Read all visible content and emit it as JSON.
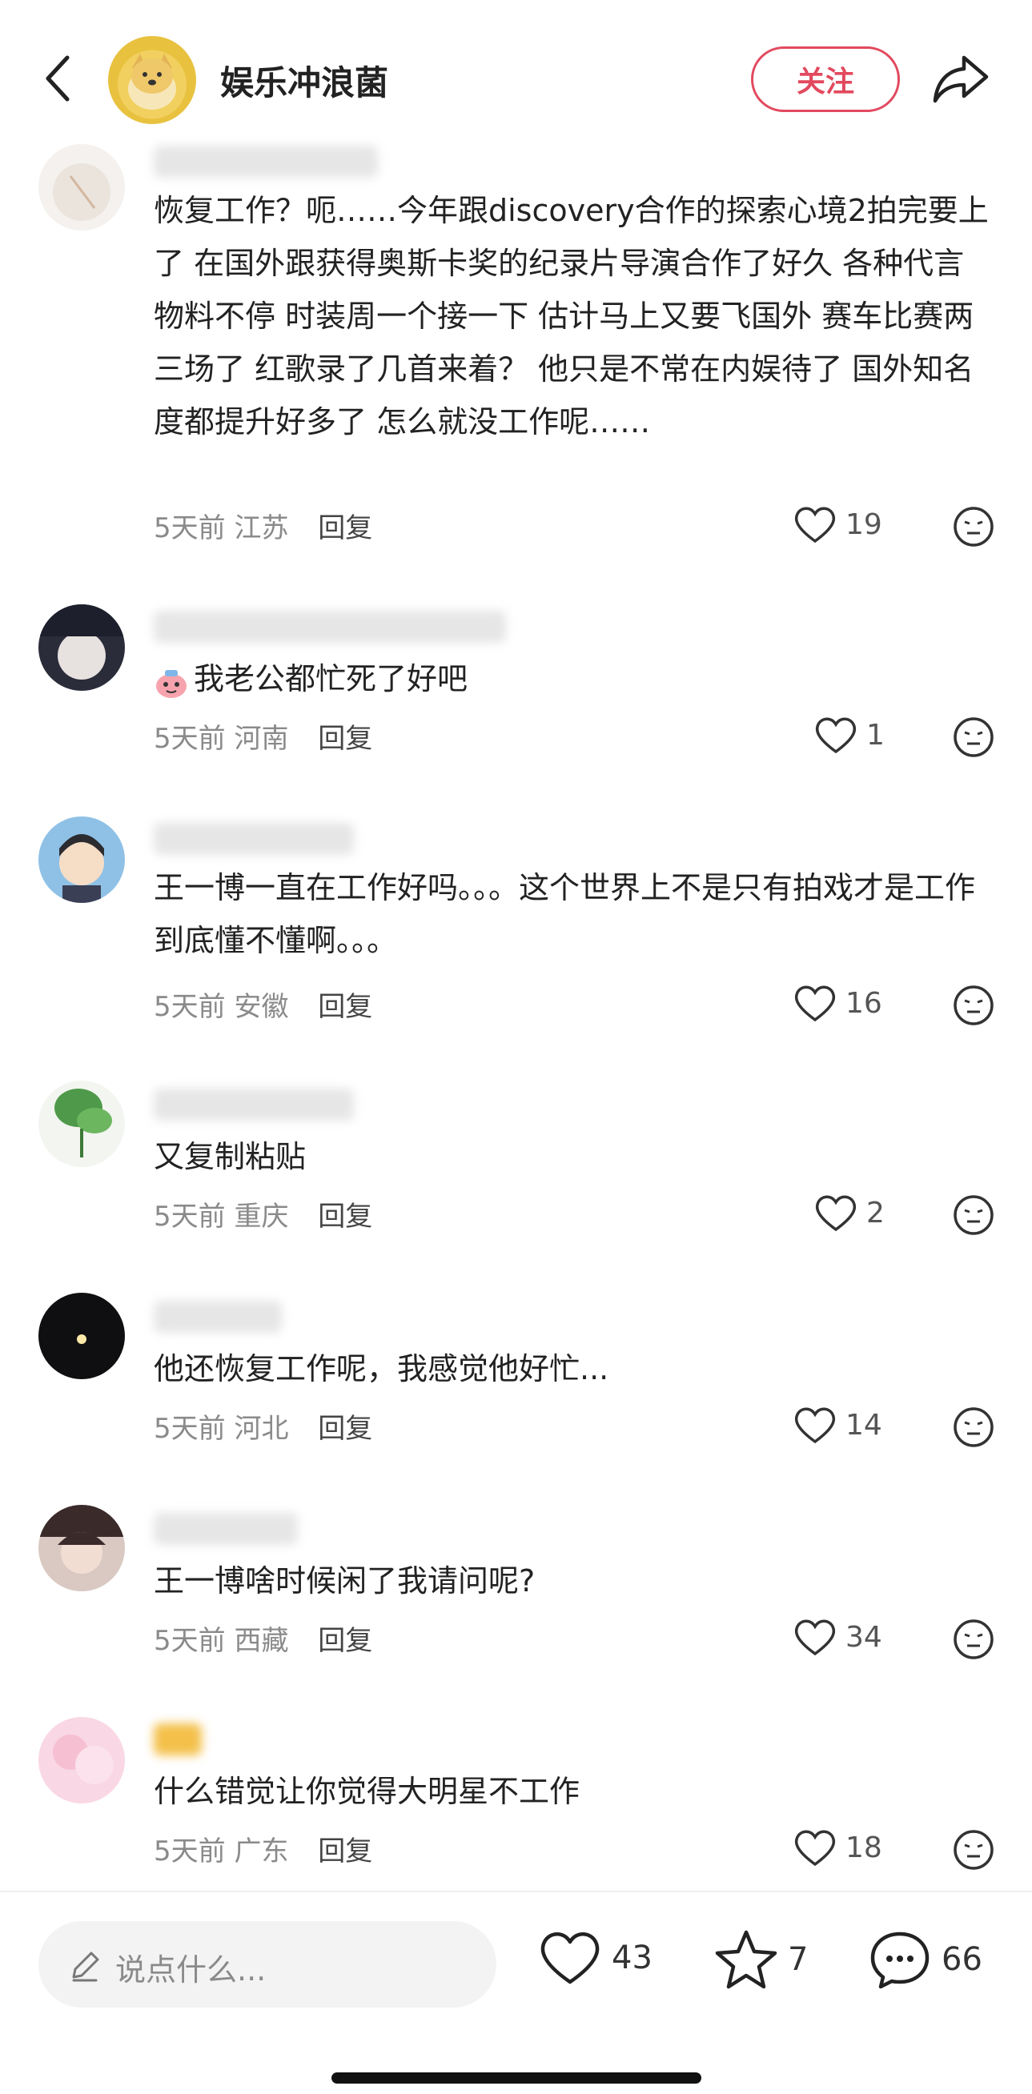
{
  "header": {
    "author_name": "娱乐冲浪菌",
    "follow_label": "关注"
  },
  "comments": [
    {
      "text": "恢复工作？呃……今年跟discovery合作的探索心境2拍完要上了 在国外跟获得奥斯卡奖的纪录片导演合作了好久 各种代言物料不停 时装周一个接一下 估计马上又要飞国外 赛车比赛两三场了 红歌录了几首来着？ 他只是不常在内娱待了 国外知名度都提升好多了 怎么就没工作呢……",
      "time": "5天前",
      "location": "江苏",
      "reply": "回复",
      "likes": "19"
    },
    {
      "text": "我老公都忙死了好吧",
      "time": "5天前",
      "location": "河南",
      "reply": "回复",
      "likes": "1"
    },
    {
      "text": "王一博一直在工作好吗。。。这个世界上不是只有拍戏才是工作到底懂不懂啊。。。",
      "time": "5天前",
      "location": "安徽",
      "reply": "回复",
      "likes": "16"
    },
    {
      "text": "又复制粘贴",
      "time": "5天前",
      "location": "重庆",
      "reply": "回复",
      "likes": "2"
    },
    {
      "text": "他还恢复工作呢，我感觉他好忙...",
      "time": "5天前",
      "location": "河北",
      "reply": "回复",
      "likes": "14"
    },
    {
      "text": "王一博啥时候闲了我请问呢?",
      "time": "5天前",
      "location": "西藏",
      "reply": "回复",
      "likes": "34"
    },
    {
      "text": "什么错觉让你觉得大明星不工作",
      "time": "5天前",
      "location": "广东",
      "reply": "回复",
      "likes": "18"
    }
  ],
  "bottom_bar": {
    "input_placeholder": "说点什么...",
    "like_count": "43",
    "star_count": "7",
    "comment_count": "66"
  },
  "icons": {
    "back": "chevron-left-icon",
    "share": "share-arrow-icon",
    "like": "heart-outline-icon",
    "emoji": "emoji-face-icon",
    "star": "star-outline-icon",
    "comment": "speech-bubble-icon",
    "pencil": "pencil-icon"
  },
  "colors": {
    "accent": "#e2495e",
    "text": "#222222",
    "meta": "#8a8a8a"
  }
}
